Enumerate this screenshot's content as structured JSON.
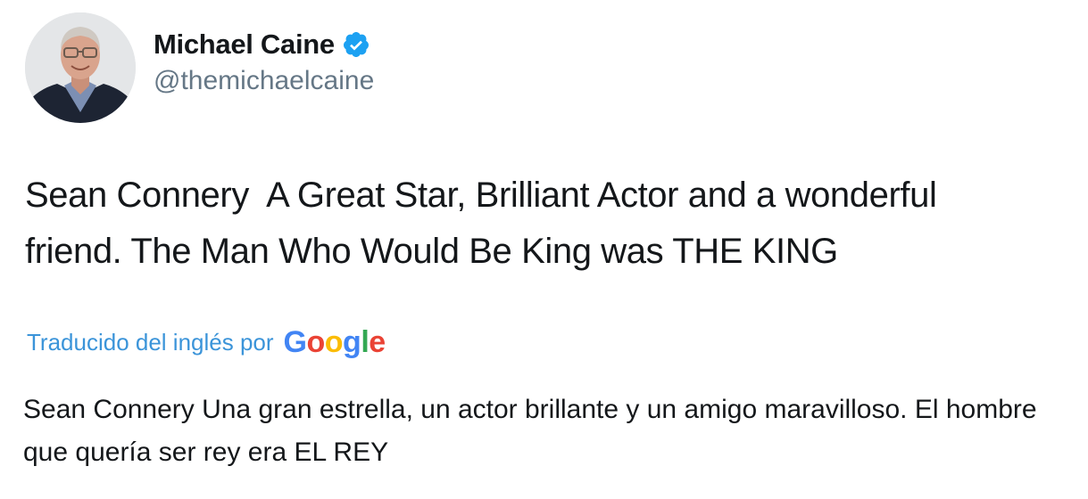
{
  "tweet": {
    "author": {
      "display_name": "Michael Caine",
      "handle": "@themichaelcaine",
      "verified": true,
      "avatar_icon": "profile-photo"
    },
    "text": "Sean Connery  A Great Star, Brilliant Actor and a wonderful\nfriend. The Man Who Would Be King was THE KING",
    "translation": {
      "label": "Traducido del inglés por",
      "provider_logo_letters": [
        "G",
        "o",
        "o",
        "g",
        "l",
        "e"
      ],
      "provider_logo_colors": [
        "#4285F4",
        "#EA4335",
        "#FBBC05",
        "#4285F4",
        "#34A853",
        "#EA4335"
      ],
      "text": "Sean Connery Una gran estrella, un actor brillante y un amigo maravilloso. El hombre que quería ser rey era EL REY"
    }
  },
  "colors": {
    "primary_text": "#14171a",
    "secondary_text": "#657786",
    "link_blue": "#3b94d9",
    "verified_blue": "#1da1f2"
  }
}
